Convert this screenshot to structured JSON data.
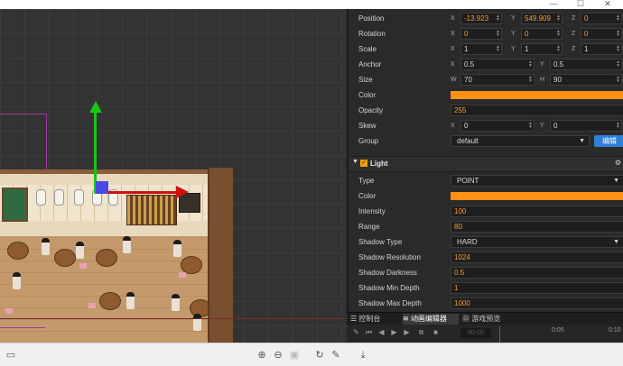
{
  "window": {
    "controls": [
      "—",
      "☐",
      "✕"
    ]
  },
  "inspector": {
    "node_rows": [
      {
        "label": "Position",
        "fields": [
          {
            "axis": "X",
            "value": "-13.923"
          },
          {
            "axis": "Y",
            "value": "549.909"
          },
          {
            "axis": "Z",
            "value": "0"
          }
        ]
      },
      {
        "label": "Rotation",
        "fields": [
          {
            "axis": "X",
            "value": "0"
          },
          {
            "axis": "Y",
            "value": "0"
          },
          {
            "axis": "Z",
            "value": "0"
          }
        ]
      },
      {
        "label": "Scale",
        "fields": [
          {
            "axis": "X",
            "value": "1"
          },
          {
            "axis": "Y",
            "value": "1"
          },
          {
            "axis": "Z",
            "value": "1"
          }
        ]
      },
      {
        "label": "Anchor",
        "fields": [
          {
            "axis": "X",
            "value": "0.5"
          },
          {
            "axis": "Y",
            "value": "0.5"
          }
        ]
      },
      {
        "label": "Size",
        "fields": [
          {
            "axis": "W",
            "value": "70"
          },
          {
            "axis": "H",
            "value": "90"
          }
        ]
      }
    ],
    "color_label": "Color",
    "color_value": "#ff8f17",
    "opacity": {
      "label": "Opacity",
      "value": "255"
    },
    "skew": {
      "label": "Skew",
      "fields": [
        {
          "axis": "X",
          "value": "0"
        },
        {
          "axis": "Y",
          "value": "0"
        }
      ]
    },
    "group": {
      "label": "Group",
      "value": "default",
      "button": "编辑"
    },
    "light_section": {
      "title": "Light",
      "enabled": true,
      "type": {
        "label": "Type",
        "value": "POINT"
      },
      "color_label": "Color",
      "color_value": "#ff8f17",
      "intensity": {
        "label": "Intensity",
        "value": "100"
      },
      "range": {
        "label": "Range",
        "value": "80"
      },
      "shadow_type": {
        "label": "Shadow Type",
        "value": "HARD"
      },
      "shadow_resolution": {
        "label": "Shadow Resolution",
        "value": "1024"
      },
      "shadow_darkness": {
        "label": "Shadow Darkness",
        "value": "0.5"
      },
      "shadow_min_depth": {
        "label": "Shadow Min Depth",
        "value": "1"
      },
      "shadow_max_depth": {
        "label": "Shadow Max Depth",
        "value": "1000"
      }
    }
  },
  "bottom_panel": {
    "tabs": [
      {
        "label": "控制台",
        "active": false
      },
      {
        "label": "动画编辑器",
        "active": true
      },
      {
        "label": "游戏预览",
        "active": false
      }
    ],
    "time_display": "00-00",
    "ticks": [
      "0:05",
      "0:10"
    ]
  },
  "colors": {
    "accent_orange": "#ff9a2a",
    "selection_blue": "#2f7fd8",
    "gizmo_y": "#19c419",
    "gizmo_x": "#d01010"
  }
}
